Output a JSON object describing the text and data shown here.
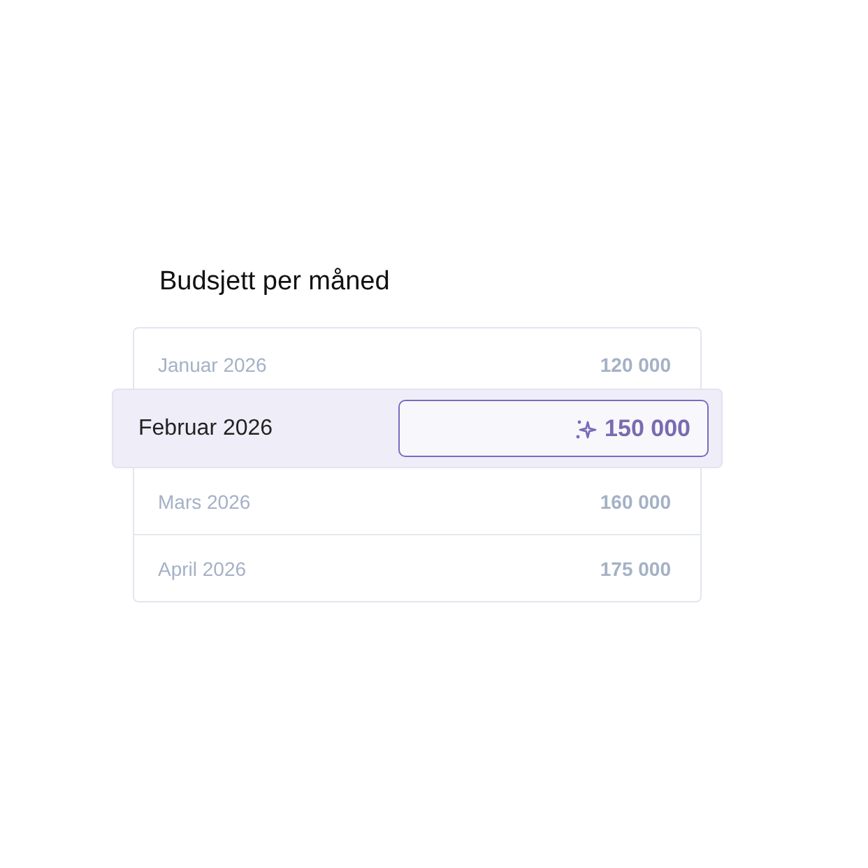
{
  "title": "Budsjett per måned",
  "months": [
    {
      "label": "Januar 2026",
      "amount": "120 000",
      "selected": false
    },
    {
      "label": "Februar 2026",
      "amount": "150 000",
      "selected": true
    },
    {
      "label": "Mars 2026",
      "amount": "160 000",
      "selected": false
    },
    {
      "label": "April 2026",
      "amount": "175 000",
      "selected": false
    }
  ]
}
